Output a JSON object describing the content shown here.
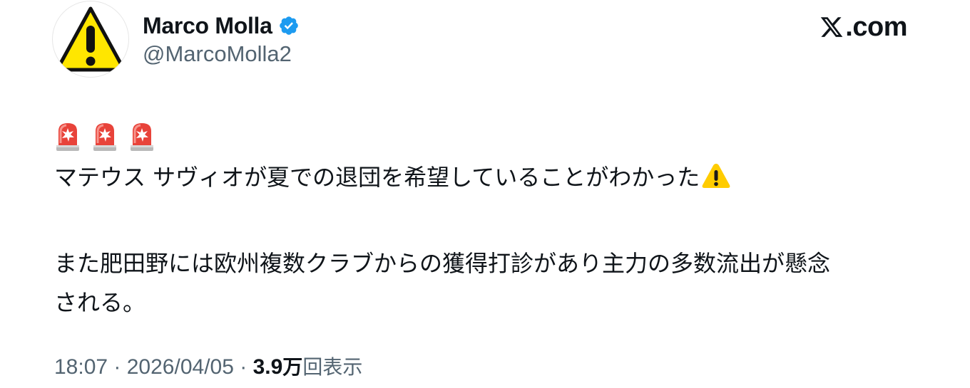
{
  "author": {
    "display_name": "Marco Molla",
    "handle": "@MarcoMolla2",
    "verified": true,
    "avatar_icon": "warning-sign-icon"
  },
  "brand": {
    "label": ".com",
    "icon": "x-logo-icon"
  },
  "tweet": {
    "leading_emojis": [
      "police-siren-icon",
      "police-siren-icon",
      "police-siren-icon"
    ],
    "line1": "マテウス サヴィオが夏での退団を希望していることがわかった",
    "line1_trailing_emoji": "warning-icon",
    "line2": "また肥田野には欧州複数クラブからの獲得打診があり主力の多数流出が懸念",
    "line3": "される。"
  },
  "meta": {
    "time": "18:07",
    "separator1": " · ",
    "date": "2026/04/05",
    "separator2": " · ",
    "views_count": "3.9",
    "views_unit": "万",
    "views_label": "回表示"
  },
  "colors": {
    "text": "#0f1419",
    "secondary": "#536471",
    "verified": "#1d9bf0",
    "warning_yellow": "#ffd60a"
  }
}
